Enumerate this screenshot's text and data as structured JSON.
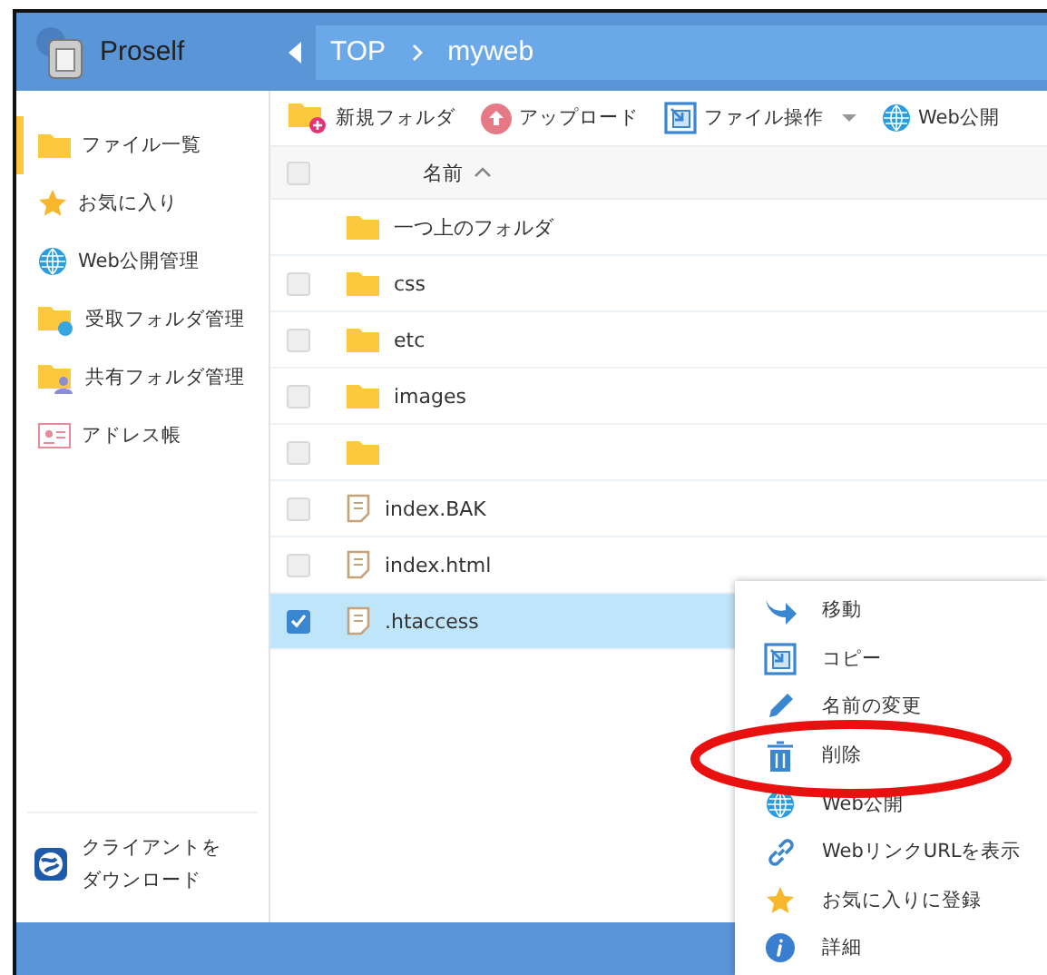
{
  "header": {
    "app_name": "Proself",
    "breadcrumb": [
      "TOP",
      "myweb"
    ]
  },
  "sidebar": {
    "items": [
      {
        "label": "ファイル一覧",
        "selected": true
      },
      {
        "label": "お気に入り",
        "selected": false
      },
      {
        "label": "Web公開管理",
        "selected": false
      },
      {
        "label": "受取フォルダ管理",
        "selected": false
      },
      {
        "label": "共有フォルダ管理",
        "selected": false
      },
      {
        "label": "アドレス帳",
        "selected": false
      }
    ],
    "download": [
      "クライアントを",
      "ダウンロード"
    ]
  },
  "toolbar": [
    {
      "label": "新規フォルダ",
      "dropdown": false
    },
    {
      "label": "アップロード",
      "dropdown": false
    },
    {
      "label": "ファイル操作",
      "dropdown": true
    },
    {
      "label": "Web公開",
      "dropdown": false
    }
  ],
  "table": {
    "select_all": {
      "checked": false
    },
    "columns": [
      "名前"
    ],
    "rows": [
      {
        "name": "一つ上のフォルダ",
        "kind": "parent",
        "selected": false
      },
      {
        "name": "css",
        "kind": "folder",
        "selected": false
      },
      {
        "name": "etc",
        "kind": "folder",
        "selected": false
      },
      {
        "name": "images",
        "kind": "folder",
        "selected": false
      },
      {
        "name": "",
        "kind": "folder",
        "selected": false
      },
      {
        "name": "index.BAK",
        "kind": "file",
        "selected": false
      },
      {
        "name": "index.html",
        "kind": "file",
        "selected": false
      },
      {
        "name": ".htaccess",
        "kind": "file",
        "selected": true
      }
    ]
  },
  "context_menu": {
    "items": [
      {
        "label": "移動",
        "highlighted": false
      },
      {
        "label": "コピー",
        "highlighted": false
      },
      {
        "label": "名前の変更",
        "highlighted": false
      },
      {
        "label": "削除",
        "highlighted": true
      },
      {
        "label": "Web公開",
        "highlighted": false
      },
      {
        "label": "WebリンクURLを表示",
        "highlighted": false
      },
      {
        "label": "お気に入りに登録",
        "highlighted": false
      },
      {
        "label": "詳細",
        "highlighted": false
      }
    ]
  }
}
